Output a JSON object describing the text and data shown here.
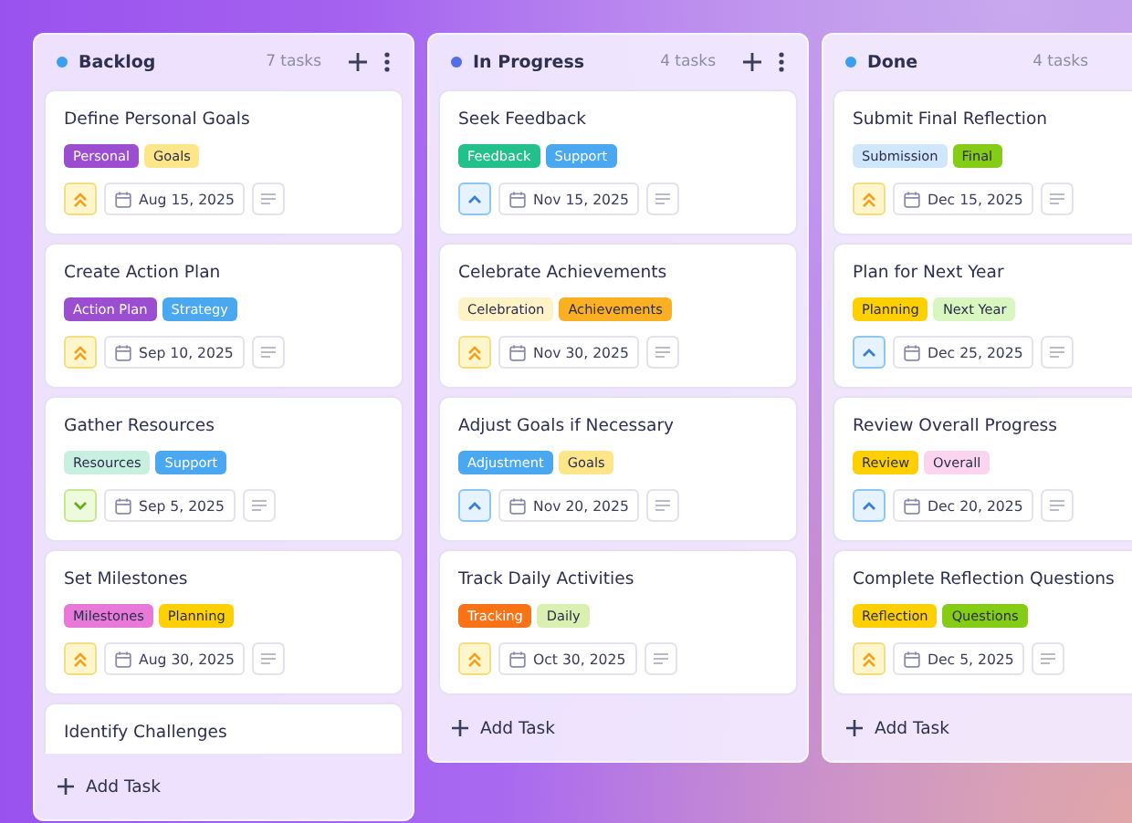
{
  "columns": [
    {
      "title": "Backlog",
      "color": "#3b9ff0",
      "count": "7 tasks",
      "actions": true,
      "add_label": "Add Task",
      "cards": [
        {
          "title": "Define Personal Goals",
          "tags": [
            {
              "label": "Personal",
              "color": "#9b4fd0"
            },
            {
              "label": "Goals",
              "color": "#fde68a"
            }
          ],
          "priority": {
            "kind": "high"
          },
          "date": "Aug 15, 2025"
        },
        {
          "title": "Create Action Plan",
          "tags": [
            {
              "label": "Action Plan",
              "color": "#9b4fd0"
            },
            {
              "label": "Strategy",
              "color": "#4aa8f0"
            }
          ],
          "priority": {
            "kind": "high"
          },
          "date": "Sep 10, 2025"
        },
        {
          "title": "Gather Resources",
          "tags": [
            {
              "label": "Resources",
              "color": "#c8f0e0"
            },
            {
              "label": "Support",
              "color": "#4aa8f0"
            }
          ],
          "priority": {
            "kind": "low"
          },
          "date": "Sep 5, 2025"
        },
        {
          "title": "Set Milestones",
          "tags": [
            {
              "label": "Milestones",
              "color": "#e879d9"
            },
            {
              "label": "Planning",
              "color": "#ffd000"
            }
          ],
          "priority": {
            "kind": "high"
          },
          "date": "Aug 30, 2025"
        },
        {
          "title": "Identify Challenges"
        }
      ]
    },
    {
      "title": "In Progress",
      "color": "#4f6ee8",
      "count": "4 tasks",
      "actions": true,
      "add_label": "Add Task",
      "cards": [
        {
          "title": "Seek Feedback",
          "tags": [
            {
              "label": "Feedback",
              "color": "#22c08a"
            },
            {
              "label": "Support",
              "color": "#4aa8f0"
            }
          ],
          "priority": {
            "kind": "medium"
          },
          "date": "Nov 15, 2025"
        },
        {
          "title": "Celebrate Achievements",
          "tags": [
            {
              "label": "Celebration",
              "color": "#fef3c7"
            },
            {
              "label": "Achievements",
              "color": "#fbb024"
            }
          ],
          "priority": {
            "kind": "high"
          },
          "date": "Nov 30, 2025"
        },
        {
          "title": "Adjust Goals if Necessary",
          "tags": [
            {
              "label": "Adjustment",
              "color": "#4aa8f0"
            },
            {
              "label": "Goals",
              "color": "#fde68a"
            }
          ],
          "priority": {
            "kind": "medium"
          },
          "date": "Nov 20, 2025"
        },
        {
          "title": "Track Daily Activities",
          "tags": [
            {
              "label": "Tracking",
              "color": "#f97316"
            },
            {
              "label": "Daily",
              "color": "#d9f0b0"
            }
          ],
          "priority": {
            "kind": "high"
          },
          "date": "Oct 30, 2025"
        }
      ]
    },
    {
      "title": "Done",
      "color": "#3b9ff0",
      "count": "4 tasks",
      "actions": false,
      "add_label": "Add Task",
      "cards": [
        {
          "title": "Submit Final Reflection",
          "tags": [
            {
              "label": "Submission",
              "color": "#cfe6fb"
            },
            {
              "label": "Final",
              "color": "#84cc16"
            }
          ],
          "priority": {
            "kind": "high"
          },
          "date": "Dec 15, 2025"
        },
        {
          "title": "Plan for Next Year",
          "tags": [
            {
              "label": "Planning",
              "color": "#ffd000"
            },
            {
              "label": "Next Year",
              "color": "#d9f5c0"
            }
          ],
          "priority": {
            "kind": "medium"
          },
          "date": "Dec 25, 2025"
        },
        {
          "title": "Review Overall Progress",
          "tags": [
            {
              "label": "Review",
              "color": "#ffd000"
            },
            {
              "label": "Overall",
              "color": "#fbd5f0"
            }
          ],
          "priority": {
            "kind": "medium"
          },
          "date": "Dec 20, 2025"
        },
        {
          "title": "Complete Reflection Questions",
          "tags": [
            {
              "label": "Reflection",
              "color": "#ffd000"
            },
            {
              "label": "Questions",
              "color": "#84cc16"
            }
          ],
          "priority": {
            "kind": "high"
          },
          "date": "Dec 5, 2025"
        }
      ]
    }
  ]
}
